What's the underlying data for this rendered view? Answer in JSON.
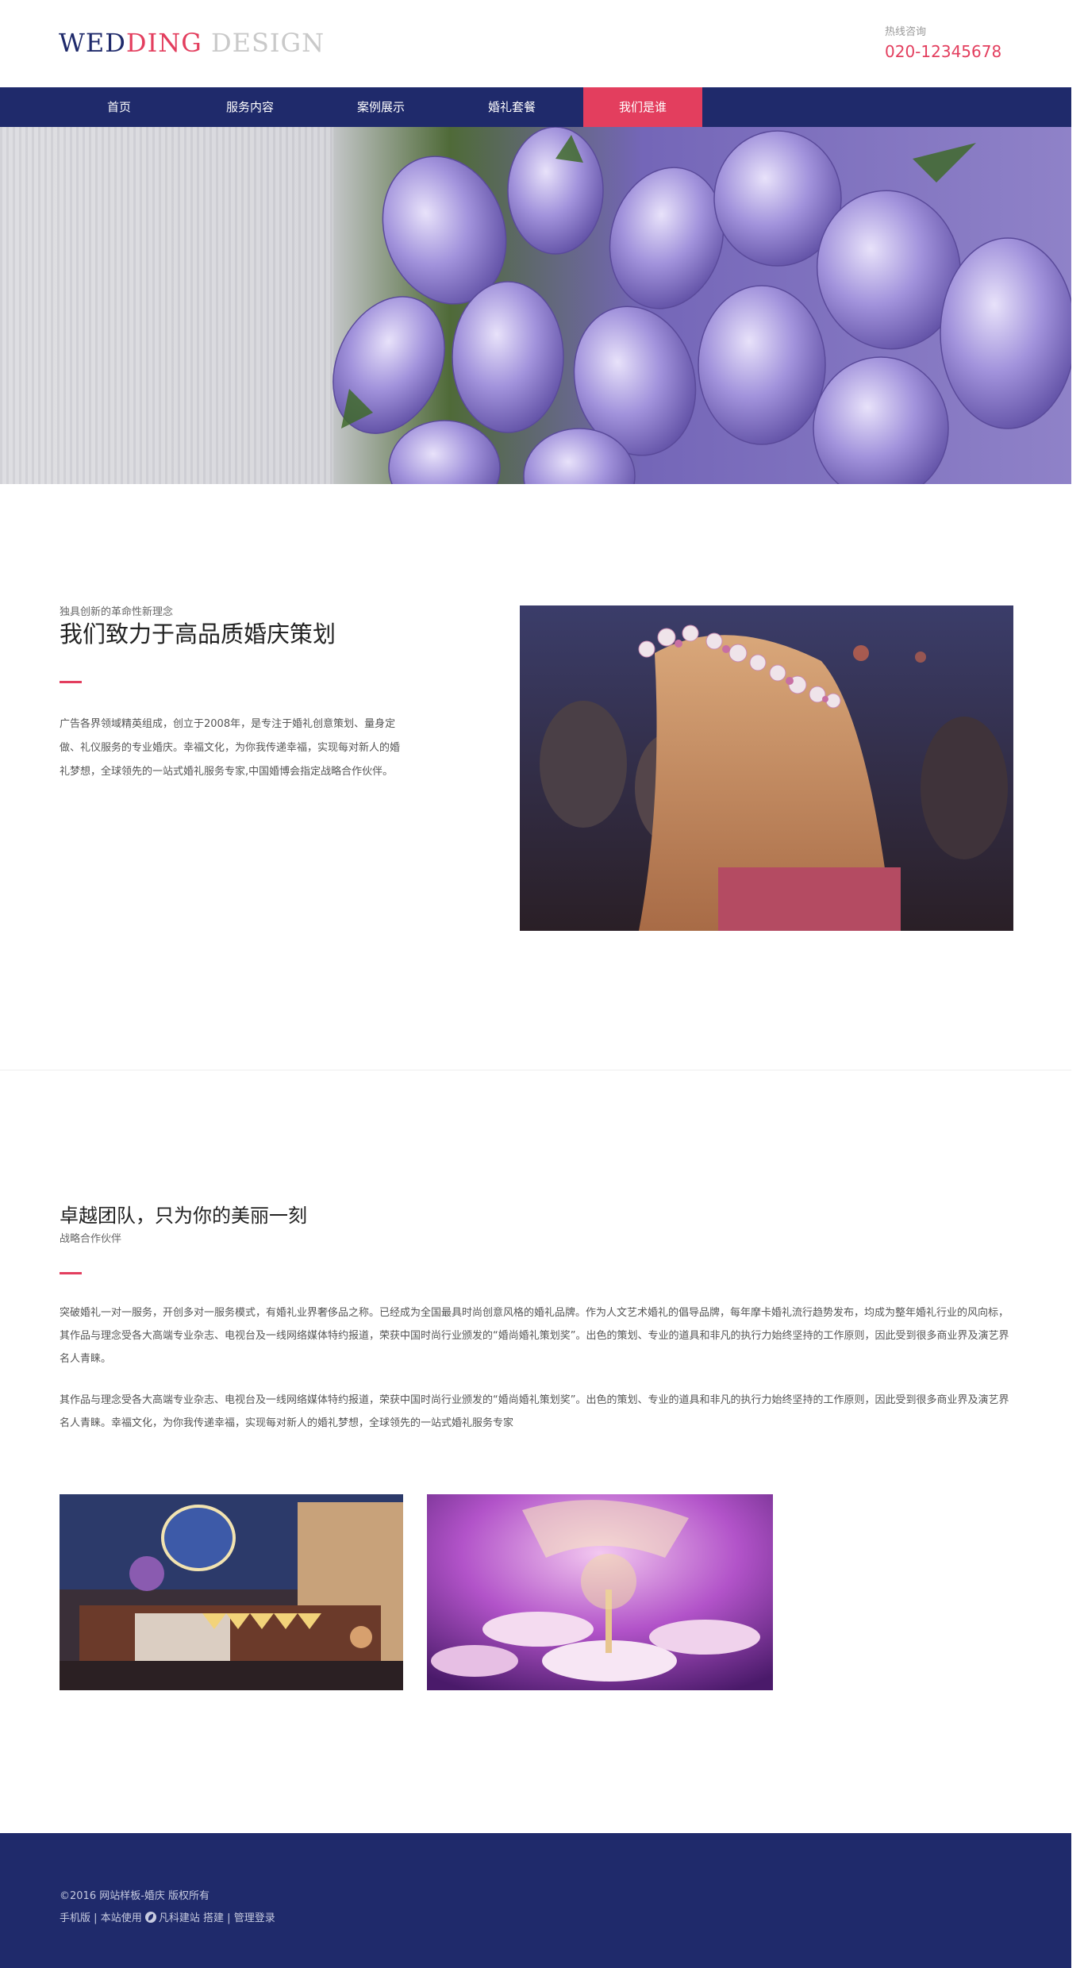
{
  "header": {
    "logo": {
      "part1": "WED",
      "part2": "DING",
      "part3": " DESIGN"
    },
    "hotline_label": "热线咨询",
    "hotline_number": "020-12345678"
  },
  "nav": {
    "items": [
      {
        "label": "首页"
      },
      {
        "label": "服务内容"
      },
      {
        "label": "案例展示"
      },
      {
        "label": "婚礼套餐"
      },
      {
        "label": "我们是谁",
        "active": true
      }
    ]
  },
  "hero": {
    "image": "purple-tulip-bouquet"
  },
  "about": {
    "subtitle": "独具创新的革命性新理念",
    "title": "我们致力于高品质婚庆策划",
    "paragraph": "广告各界领域精英组成，创立于2008年，是专注于婚礼创意策划、量身定做、礼仪服务的专业婚庆。幸福文化，为你我传递幸福，实现每对新人的婚礼梦想，全球领先的一站式婚礼服务专家,中国婚博会指定战略合作伙伴。",
    "image": "bride-flower-crown-photo"
  },
  "team": {
    "title": "卓越团队，只为你的美丽一刻",
    "subtitle": "战略合作伙伴",
    "paragraph1": "突破婚礼一对一服务，开创多对一服务模式，有婚礼业界奢侈品之称。已经成为全国最具时尚创意风格的婚礼品牌。作为人文艺术婚礼的倡导品牌，每年摩卡婚礼流行趋势发布，均成为整年婚礼行业的风向标，其作品与理念受各大高端专业杂志、电视台及一线网络媒体特约报道，荣获中国时尚行业颁发的“婚尚婚礼策划奖”。出色的策划、专业的道具和非凡的执行力始终坚持的工作原则，因此受到很多商业界及演艺界名人青睐。",
    "paragraph2": "其作品与理念受各大高端专业杂志、电视台及一线网络媒体特约报道，荣获中国时尚行业颁发的“婚尚婚礼策划奖”。出色的策划、专业的道具和非凡的执行力始终坚持的工作原则，因此受到很多商业界及演艺界名人青睐。幸福文化，为你我传递幸福，实现每对新人的婚礼梦想，全球领先的一站式婚礼服务专家",
    "images": [
      "wedding-dessert-table-photo",
      "purple-banquet-hall-photo"
    ]
  },
  "footer": {
    "copyright": "©2016 网站样板-婚庆 版权所有",
    "link_mobile": "手机版",
    "sep": "|",
    "powered_prefix": "本站使用",
    "powered_brand": "凡科建站",
    "powered_suffix": "搭建",
    "link_admin": "管理登录"
  },
  "colors": {
    "navy": "#1f2a6b",
    "accent": "#e33e5e",
    "logo_gray": "#c9c9c9"
  }
}
